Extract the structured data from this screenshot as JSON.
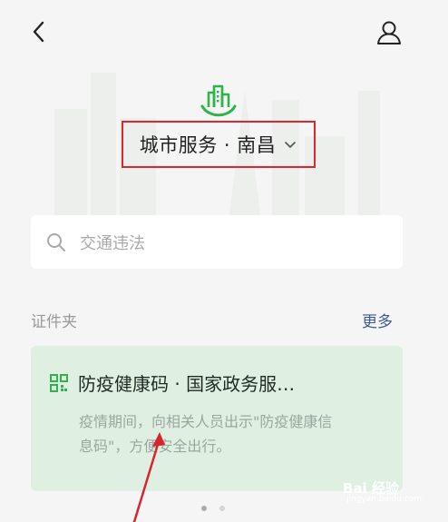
{
  "header": {
    "back_icon": "chevron-left-icon",
    "user_icon": "person-icon"
  },
  "city": {
    "title": "城市服务 · 南昌",
    "logo_icon": "city-buildings-icon",
    "dropdown_icon": "chevron-down-icon"
  },
  "search": {
    "placeholder": "交通违法",
    "icon": "search-icon"
  },
  "certificates": {
    "section_title": "证件夹",
    "more_label": "更多",
    "card": {
      "icon": "qr-code-icon",
      "title": "防疫健康码 · 国家政务服…",
      "description": "疫情期间，向相关人员出示\"防疫健康信息码\"，方便安全出行。"
    }
  },
  "pagination": {
    "active_page": 1,
    "total_pages": 2
  },
  "watermark": {
    "text": "Bai 经验",
    "subtext": "jingyan.baidu.com"
  },
  "colors": {
    "accent_green": "#2fb34a",
    "highlight_red": "#e0262a",
    "link_blue": "#3e5c8f",
    "card_bg": "#dff0e3"
  }
}
